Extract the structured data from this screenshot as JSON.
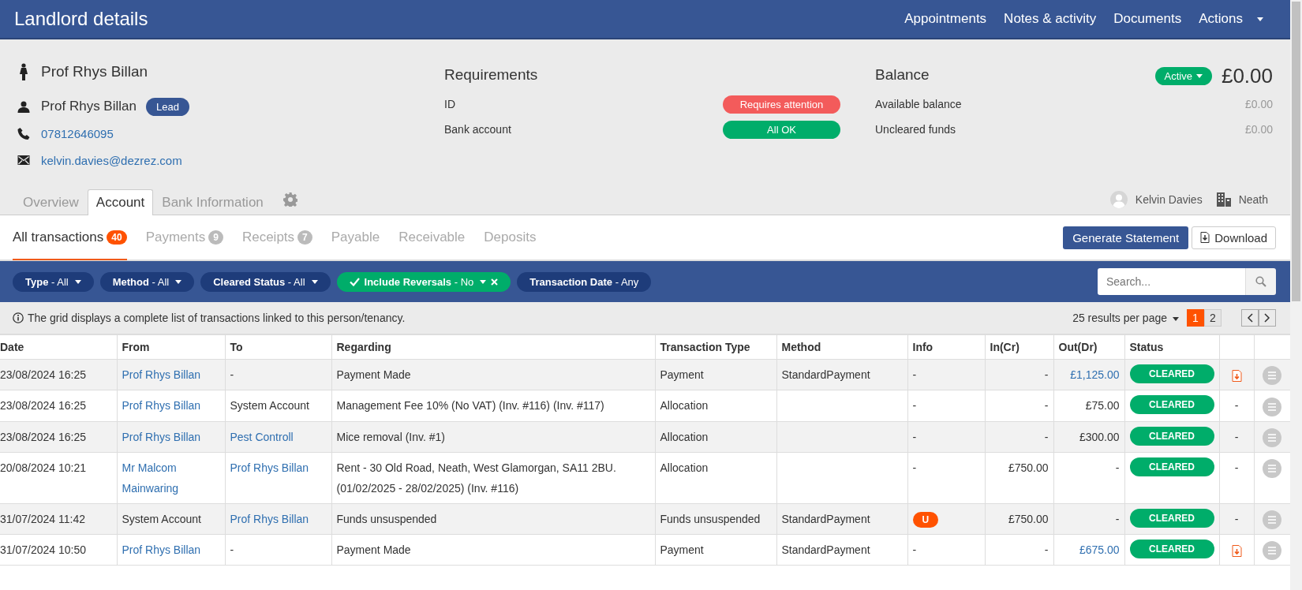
{
  "header": {
    "title": "Landlord details",
    "menu": [
      {
        "label": "Appointments",
        "dropdown": false
      },
      {
        "label": "Notes & activity",
        "dropdown": false
      },
      {
        "label": "Documents",
        "dropdown": false
      },
      {
        "label": "Actions",
        "dropdown": true
      }
    ]
  },
  "person": {
    "title_name": "Prof Rhys Billan",
    "contact_name": "Prof Rhys Billan",
    "contact_badge": "Lead",
    "phone": "07812646095",
    "email": "kelvin.davies@dezrez.com"
  },
  "requirements": {
    "title": "Requirements",
    "items": [
      {
        "label": "ID",
        "status": "Requires attention",
        "kind": "attention"
      },
      {
        "label": "Bank account",
        "status": "All OK",
        "kind": "ok"
      }
    ]
  },
  "balance": {
    "title": "Balance",
    "state": "Active",
    "amount": "£0.00",
    "items": [
      {
        "label": "Available balance",
        "value": "£0.00"
      },
      {
        "label": "Uncleared funds",
        "value": "£0.00"
      }
    ]
  },
  "tabs": [
    {
      "label": "Overview",
      "selected": false
    },
    {
      "label": "Account",
      "selected": true
    },
    {
      "label": "Bank Information",
      "selected": false
    }
  ],
  "owner": {
    "negotiator": "Kelvin Davies",
    "branch": "Neath"
  },
  "subtabs": [
    {
      "label": "All transactions",
      "count": "40",
      "selected": true
    },
    {
      "label": "Payments",
      "count": "9",
      "selected": false
    },
    {
      "label": "Receipts",
      "count": "7",
      "selected": false
    },
    {
      "label": "Payable",
      "selected": false
    },
    {
      "label": "Receivable",
      "selected": false
    },
    {
      "label": "Deposits",
      "selected": false
    }
  ],
  "actions": {
    "primary": "Generate Statement",
    "secondary": "Download"
  },
  "filters": [
    {
      "text": "**Type** - All",
      "active": false
    },
    {
      "text": "**Method** - All",
      "active": false
    },
    {
      "text": "**Cleared Status** - All",
      "active": false
    },
    {
      "text": "**Include Reversals** - No",
      "active": true
    },
    {
      "text": "**Transaction Date** - Any",
      "active": false,
      "dropdown": false
    }
  ],
  "search": {
    "placeholder": "Search..."
  },
  "grid_note": "The grid displays a complete list of transactions linked to this person/tenancy.",
  "paging": {
    "per_page": "25 results per page",
    "pages": [
      {
        "label": "1",
        "selected": true
      },
      {
        "label": "2",
        "selected": false
      }
    ]
  },
  "table": {
    "columns": [
      "Date",
      "From",
      "To",
      "Regarding",
      "Transaction Type",
      "Method",
      "Info",
      "In(Cr)",
      "Out(Dr)",
      "Status"
    ],
    "rows": [
      {
        "date": "23/08/2024 16:25",
        "from": {
          "text": "Prof Rhys Billan",
          "link": true
        },
        "to": {
          "text": "-",
          "link": false
        },
        "regarding": "Payment Made",
        "transaction_type": "Payment",
        "method": "StandardPayment",
        "info": {
          "text": "-",
          "kind": "plain"
        },
        "in_cr": "-",
        "out_dr": {
          "text": "£1,125.00",
          "link": true
        },
        "status": "CLEARED",
        "attachment": true
      },
      {
        "date": "23/08/2024 16:25",
        "from": {
          "text": "Prof Rhys Billan",
          "link": true
        },
        "to": {
          "text": "System Account",
          "link": false
        },
        "regarding": "Management Fee 10% (No VAT) (Inv. #116) (Inv. #117)",
        "transaction_type": "Allocation",
        "info": {
          "text": "-",
          "kind": "plain"
        },
        "in_cr": "-",
        "out_dr": {
          "text": "£75.00",
          "link": false
        },
        "status": "CLEARED",
        "attachment": false,
        "attachment_text": "-"
      },
      {
        "date": "23/08/2024 16:25",
        "from": {
          "text": "Prof Rhys Billan",
          "link": true
        },
        "to": {
          "text": "Pest Controll",
          "link": true
        },
        "regarding": "Mice removal (Inv. #1)",
        "transaction_type": "Allocation",
        "info": {
          "text": "-",
          "kind": "plain"
        },
        "in_cr": "-",
        "out_dr": {
          "text": "£300.00",
          "link": false
        },
        "status": "CLEARED",
        "attachment": false,
        "attachment_text": "-"
      },
      {
        "date": "20/08/2024 10:21",
        "from": {
          "text": "Mr Malcom Mainwaring",
          "link": true
        },
        "to": {
          "text": "Prof Rhys Billan",
          "link": true
        },
        "regarding": "Rent - 30 Old Road, Neath, West Glamorgan, SA11 2BU. (01/02/2025 - 28/02/2025) (Inv. #116)",
        "transaction_type": "Allocation",
        "info": {
          "text": "-",
          "kind": "plain"
        },
        "in_cr": "£750.00",
        "out_dr": {
          "text": "-",
          "link": false
        },
        "status": "CLEARED",
        "attachment": false,
        "attachment_text": "-"
      },
      {
        "date": "31/07/2024 11:42",
        "from": {
          "text": "System Account",
          "link": false
        },
        "to": {
          "text": "Prof Rhys Billan",
          "link": true
        },
        "regarding": "Funds unsuspended",
        "transaction_type": "Funds unsuspended",
        "method": "StandardPayment",
        "info": {
          "text": "U",
          "kind": "badge"
        },
        "in_cr": "£750.00",
        "out_dr": {
          "text": "-",
          "link": false
        },
        "status": "CLEARED",
        "attachment": false,
        "attachment_text": "-"
      },
      {
        "date": "31/07/2024 10:50",
        "from": {
          "text": "Prof Rhys Billan",
          "link": true
        },
        "to": {
          "text": "-",
          "link": false
        },
        "regarding": "Payment Made",
        "transaction_type": "Payment",
        "method": "StandardPayment",
        "info": {
          "text": "-",
          "kind": "plain"
        },
        "in_cr": "-",
        "out_dr": {
          "text": "£675.00",
          "link": true
        },
        "status": "CLEARED",
        "attachment": true
      }
    ]
  }
}
